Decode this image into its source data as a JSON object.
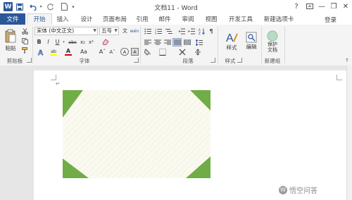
{
  "window": {
    "title": "文档11 - Word",
    "app_icon_letter": "W",
    "help_label": "?",
    "controls": {
      "minimize": "—",
      "restore": "❐",
      "close": "✕"
    },
    "ribbon_collapse": "↑"
  },
  "quick_access": {
    "save_icon": "save-icon",
    "undo_icon": "undo-icon",
    "redo_icon": "redo-icon",
    "new_icon": "new-document-icon",
    "customize_icon": "customize-icon"
  },
  "tabs": [
    {
      "label": "文件"
    },
    {
      "label": "开始"
    },
    {
      "label": "插入"
    },
    {
      "label": "设计"
    },
    {
      "label": "页面布局"
    },
    {
      "label": "引用"
    },
    {
      "label": "邮件"
    },
    {
      "label": "审阅"
    },
    {
      "label": "视图"
    },
    {
      "label": "开发工具"
    },
    {
      "label": "新建选项卡"
    }
  ],
  "login_label": "登录",
  "ribbon": {
    "clipboard": {
      "group_label": "剪贴板",
      "paste_label": "粘贴"
    },
    "font": {
      "group_label": "字体",
      "font_name": "宋体 (中文正文)",
      "font_size": "五号",
      "bold": "B",
      "italic": "I",
      "underline": "U",
      "strikethrough": "abc",
      "subscript": "x₂",
      "superscript": "x²",
      "grow_font": "Aˆ",
      "shrink_font": "Aˇ",
      "change_case": "Aa",
      "font_color_letter": "A",
      "highlight_letter": "ab",
      "wen": "文",
      "char_border": "A",
      "phonetic": "wén",
      "char_shading": "A"
    },
    "paragraph": {
      "group_label": "段落"
    },
    "styles": {
      "group_label": "样式",
      "styles_label": "样式"
    },
    "editing": {
      "editing_label": "编辑"
    },
    "new_group": {
      "group_label": "新建组",
      "protect_label_1": "保护",
      "protect_label_2": "文档"
    }
  },
  "document": {
    "paragraph_mark": "↵"
  },
  "watermark": {
    "text": "悟空问答",
    "badge": "W"
  },
  "colors": {
    "word_blue": "#2b579a",
    "shape_fill": "#fbfaf0",
    "corner_green": "#70ad47",
    "font_color_red": "#d00000",
    "highlight_yellow": "#ffff00"
  }
}
